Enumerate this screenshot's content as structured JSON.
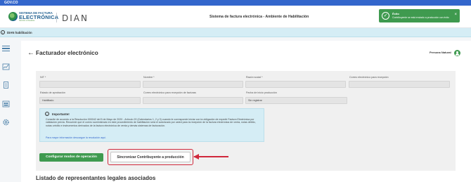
{
  "gov_bar": {
    "label": "GOV.CO"
  },
  "header": {
    "logo": {
      "line1": "SISTEMA DE FACTURA",
      "line2": "ELECTRÓNICA",
      "line3": "Servicio a Usuarios"
    },
    "dian": "DIAN",
    "title": "Sistema de factura electrónica - Ambiente de Habilitación"
  },
  "toast": {
    "title": "Éxito",
    "message": "Contribuyente se está enviado a producción con éxito",
    "close": "×",
    "check": "✓"
  },
  "habilitacion_bar": {
    "icon": "i",
    "label": "DIAN habilitación"
  },
  "sidebar": {
    "icons": [
      "menu-icon",
      "chart-icon",
      "document-icon",
      "users-icon",
      "settings-icon"
    ]
  },
  "page": {
    "back": "←",
    "title": "Facturador electrónico",
    "persona": "Persona Natural"
  },
  "form": {
    "nit_label": "NIT *",
    "nombre_label": "Nombre *",
    "razon_label": "Razón social *",
    "correo_label": "Correo electrónico para recepción",
    "estado_label": "Estado de aprobación",
    "estado_value": "Habilitado",
    "correo_fact_label": "Correo electrónico para recepción de facturas",
    "fecha_label": "Fecha de inicio producción",
    "fecha_value": "Sin registrar"
  },
  "notice": {
    "icon": "i",
    "title": "Importante!",
    "body": "Consulte de acuerdo a la Resolución 000042 del 5 de Mayo de 2020 - Artículo 20 (Calendarios 1, 2 y 3) cuando le corresponde iniciar con la obligación de expedir Factura Electrónica por validación previa. Recuerde que el correo suministrado en este procedimiento de habilitación será el autorizado por usted para la recepción de la factura electrónica de venta, notas débito, notas crédito e instrumentos derivados de la factura electrónica de venta y demás sistemas de facturación.",
    "link": "Para mayor información descargue la resolución aquí."
  },
  "buttons": {
    "configurar": "Configurar modos de operación",
    "sincronizar": "Sincronizar Contribuyente a producción"
  },
  "section": {
    "title": "Listado de representantes legales asociados"
  }
}
